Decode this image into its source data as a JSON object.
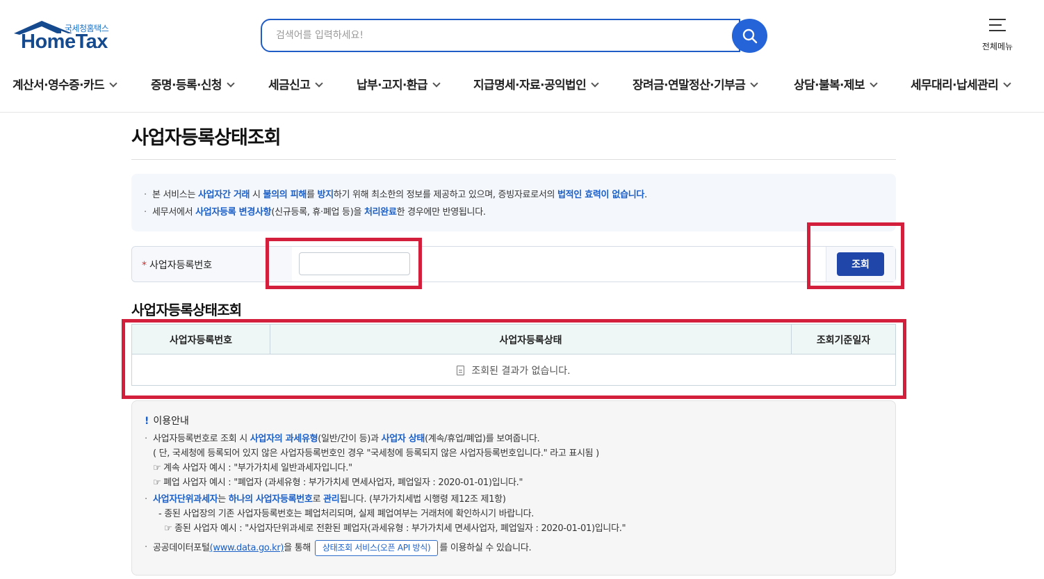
{
  "header": {
    "logo_sub": "국세청홈택스",
    "logo_main": "HomeTax",
    "search_placeholder": "검색어를 입력하세요!",
    "all_menu_label": "전체메뉴"
  },
  "nav": {
    "items": [
      {
        "label": "계산서·영수증·카드"
      },
      {
        "label": "증명·등록·신청"
      },
      {
        "label": "세금신고"
      },
      {
        "label": "납부·고지·환급"
      },
      {
        "label": "지급명세·자료·공익법인"
      },
      {
        "label": "장려금·연말정산·기부금"
      },
      {
        "label": "상담·불복·제보"
      },
      {
        "label": "세무대리·납세관리"
      }
    ]
  },
  "main": {
    "title": "사업자등록상태조회",
    "notice": {
      "line1": [
        "본 서비스는 ",
        "사업자간 거래",
        " 시 ",
        "불의의 피해",
        "를 ",
        "방지",
        "하기 위해 최소한의 정보를 제공하고 있으며, 증빙자료로서의 ",
        "법적인 효력이 없습니다",
        "."
      ],
      "line2": [
        "세무서에서 ",
        "사업자등록 변경사항",
        "(신규등록, 휴·폐업 등)을 ",
        "처리완료",
        "한 경우에만 반영됩니다."
      ]
    },
    "form": {
      "required_mark": "*",
      "label": "사업자등록번호",
      "input_value": "",
      "search_button": "조회"
    },
    "result": {
      "section_title": "사업자등록상태조회",
      "columns": [
        "사업자등록번호",
        "사업자등록상태",
        "조회기준일자"
      ],
      "empty_message": "조회된 결과가 없습니다."
    },
    "guide": {
      "mark": "!",
      "title": "이용안내",
      "l1": [
        "사업자등록번호로 조회 시 ",
        "사업자의 과세유형",
        "(일반/간이 등)과 ",
        "사업자 상태",
        "(계속/휴업/폐업)를 보여줍니다."
      ],
      "l2": "( 단, 국세청에 등록되어 있지 않은 사업자등록번호인 경우 \"국세청에 등록되지 않은 사업자등록번호입니다.\" 라고 표시됨 )",
      "l3": "☞ 계속 사업자 예시 : \"부가가치세 일반과세자입니다.\"",
      "l4": "☞ 폐업 사업자 예시 : \"폐업자 (과세유형 : 부가가치세 면세사업자, 폐업일자 : 2020-01-01)입니다.\"",
      "l5": [
        "사업자단위과세자",
        "는 ",
        "하나의 사업자등록번호",
        "로 ",
        "관리",
        "됩니다. (부가가치세법 시행령 제12조 제1항)"
      ],
      "l6": "- 종된 사업장의 기존 사업자등록번호는 폐업처리되며, 실제 폐업여부는 거래처에 확인하시기 바랍니다.",
      "l7": "☞ 종된 사업자 예시 : \"사업자단위과세로 전환된 폐업자(과세유형 : 부가가치세 면세사업자, 폐업일자 : 2020-01-01)입니다.\"",
      "l8_pre": "공공데이터포털",
      "l8_link": "(www.data.go.kr)",
      "l8_mid": "을 통해",
      "l8_btn": "상태조회 서비스(오픈 API 방식)",
      "l8_post": "를 이용하실 수 있습니다."
    }
  },
  "colors": {
    "brand_blue": "#1f5cc6",
    "button_navy": "#1f46a8",
    "highlight": "#1a5fc8",
    "annotation_red": "#d41f3c"
  }
}
